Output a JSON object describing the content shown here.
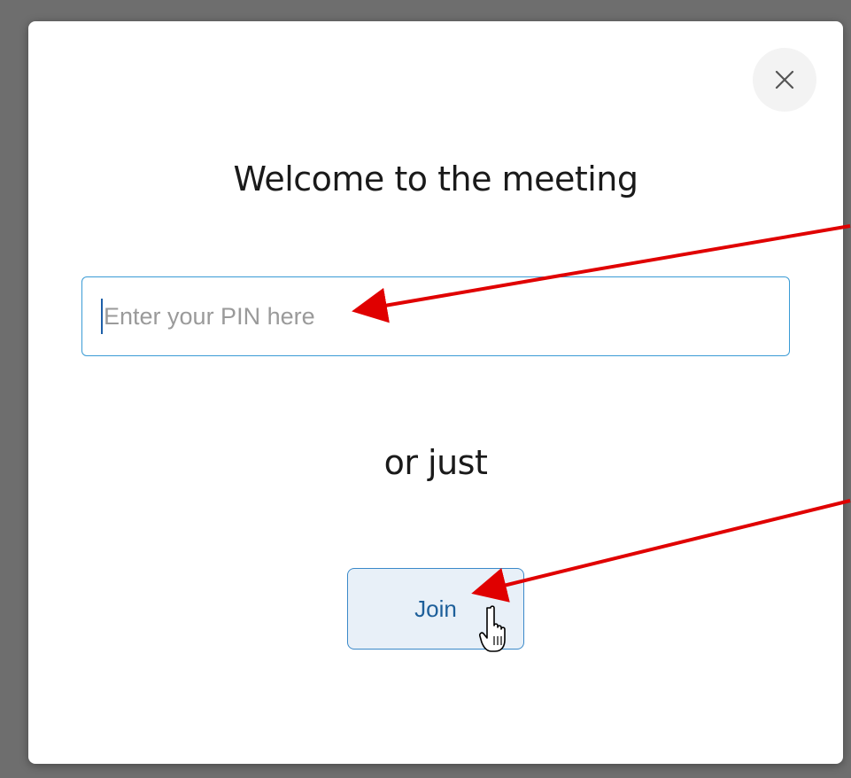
{
  "dialog": {
    "title": "Welcome to the meeting",
    "close_icon": "close-icon",
    "pin_input": {
      "value": "",
      "placeholder": "Enter your PIN here"
    },
    "or_text": "or just",
    "join_label": "Join"
  },
  "colors": {
    "backdrop": "#6e6e6e",
    "dialog_bg": "#ffffff",
    "input_border": "#3a9bd5",
    "join_bg": "#e8f0f8",
    "join_border": "#3a89c9",
    "join_text": "#1d5f9a",
    "annotation_arrow": "#e00000"
  },
  "icons": {
    "close": "close-icon",
    "cursor": "hand-pointer-icon",
    "arrows": "annotation-arrow"
  }
}
